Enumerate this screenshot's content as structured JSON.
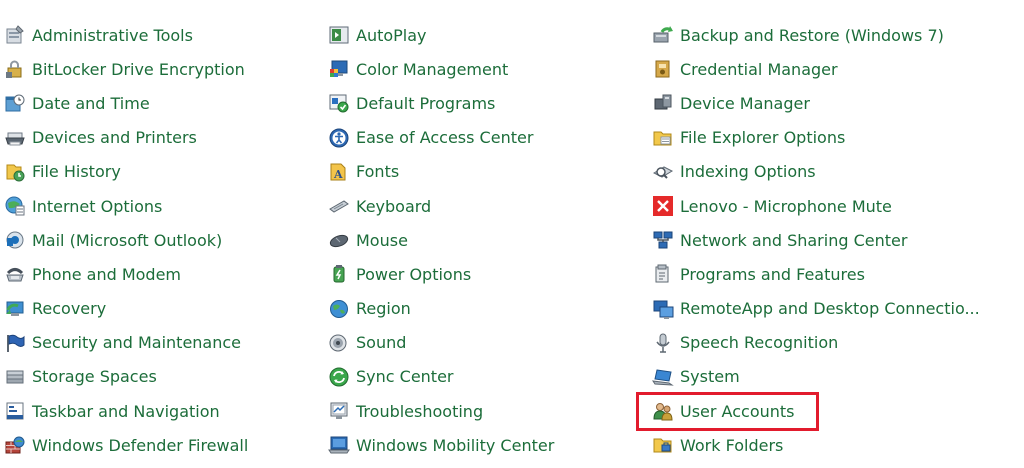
{
  "columns": [
    {
      "items": [
        {
          "label": "Administrative Tools",
          "icon": "administrative-tools-icon"
        },
        {
          "label": "BitLocker Drive Encryption",
          "icon": "bitlocker-icon"
        },
        {
          "label": "Date and Time",
          "icon": "date-time-icon"
        },
        {
          "label": "Devices and Printers",
          "icon": "printer-icon"
        },
        {
          "label": "File History",
          "icon": "file-history-icon"
        },
        {
          "label": "Internet Options",
          "icon": "internet-options-icon"
        },
        {
          "label": "Mail (Microsoft Outlook)",
          "icon": "mail-icon"
        },
        {
          "label": "Phone and Modem",
          "icon": "phone-modem-icon"
        },
        {
          "label": "Recovery",
          "icon": "recovery-icon"
        },
        {
          "label": "Security and Maintenance",
          "icon": "security-flag-icon"
        },
        {
          "label": "Storage Spaces",
          "icon": "storage-spaces-icon"
        },
        {
          "label": "Taskbar and Navigation",
          "icon": "taskbar-icon"
        },
        {
          "label": "Windows Defender Firewall",
          "icon": "firewall-icon"
        }
      ]
    },
    {
      "items": [
        {
          "label": "AutoPlay",
          "icon": "autoplay-icon"
        },
        {
          "label": "Color Management",
          "icon": "color-management-icon"
        },
        {
          "label": "Default Programs",
          "icon": "default-programs-icon"
        },
        {
          "label": "Ease of Access Center",
          "icon": "ease-of-access-icon"
        },
        {
          "label": "Fonts",
          "icon": "fonts-icon"
        },
        {
          "label": "Keyboard",
          "icon": "keyboard-icon"
        },
        {
          "label": "Mouse",
          "icon": "mouse-icon"
        },
        {
          "label": "Power Options",
          "icon": "power-options-icon"
        },
        {
          "label": "Region",
          "icon": "region-globe-icon"
        },
        {
          "label": "Sound",
          "icon": "sound-icon"
        },
        {
          "label": "Sync Center",
          "icon": "sync-center-icon"
        },
        {
          "label": "Troubleshooting",
          "icon": "troubleshooting-icon"
        },
        {
          "label": "Windows Mobility Center",
          "icon": "mobility-center-icon"
        }
      ]
    },
    {
      "items": [
        {
          "label": "Backup and Restore (Windows 7)",
          "icon": "backup-restore-icon"
        },
        {
          "label": "Credential Manager",
          "icon": "credential-manager-icon"
        },
        {
          "label": "Device Manager",
          "icon": "device-manager-icon"
        },
        {
          "label": "File Explorer Options",
          "icon": "folder-options-icon"
        },
        {
          "label": "Indexing Options",
          "icon": "indexing-options-icon"
        },
        {
          "label": "Lenovo - Microphone Mute",
          "icon": "lenovo-mic-mute-icon"
        },
        {
          "label": "Network and Sharing Center",
          "icon": "network-sharing-icon"
        },
        {
          "label": "Programs and Features",
          "icon": "programs-features-icon"
        },
        {
          "label": "RemoteApp and Desktop Connectio...",
          "icon": "remoteapp-icon"
        },
        {
          "label": "Speech Recognition",
          "icon": "microphone-icon"
        },
        {
          "label": "System",
          "icon": "system-laptop-icon"
        },
        {
          "label": "User Accounts",
          "icon": "user-accounts-icon",
          "highlighted": true
        },
        {
          "label": "Work Folders",
          "icon": "work-folders-icon"
        }
      ]
    }
  ],
  "colors": {
    "link": "#1c6d3a",
    "highlight_border": "#e21b2d"
  }
}
